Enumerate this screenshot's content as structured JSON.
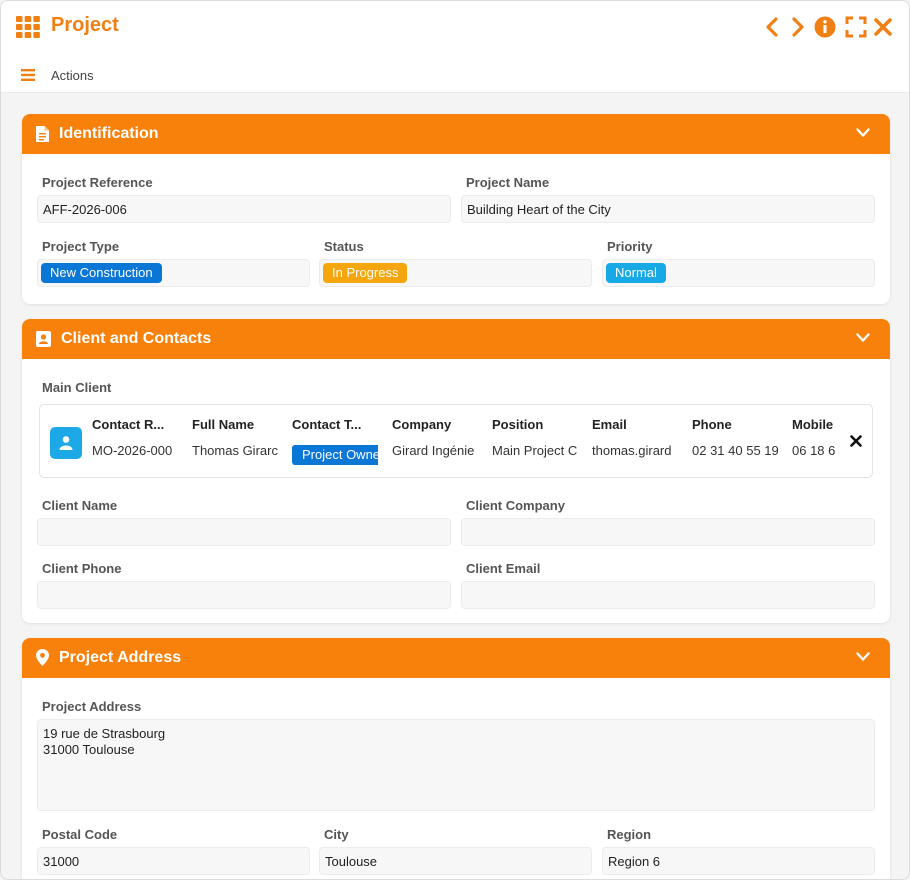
{
  "window": {
    "title": "Project",
    "accent": "#f07f14",
    "controls": [
      "chevron-left-icon",
      "chevron-right-icon",
      "info-icon",
      "fullscreen-icon",
      "close-icon"
    ]
  },
  "menubar": {
    "actions_label": "Actions"
  },
  "identification": {
    "title": "Identification",
    "project_reference_label": "Project Reference",
    "project_reference_value": "AFF-2026-006",
    "project_name_label": "Project Name",
    "project_name_value": "Building Heart of the City",
    "project_type_label": "Project Type",
    "project_type_value": "New Construction",
    "project_type_color": "#0a76d6",
    "status_label": "Status",
    "status_value": "In Progress",
    "status_color": "#f5a60c",
    "priority_label": "Priority",
    "priority_value": "Normal",
    "priority_color": "#16a9e6"
  },
  "client": {
    "title": "Client and Contacts",
    "main_client_label": "Main Client",
    "contact_columns": [
      "Contact R...",
      "Full Name",
      "Contact T...",
      "Company",
      "Position",
      "Email",
      "Phone",
      "Mobile"
    ],
    "contact_row": [
      "MO-2026-000",
      "Thomas Girarc",
      "Project Owne",
      "Girard Ingénie",
      "Main Project C",
      "thomas.girard",
      "02 31 40 55 19",
      "06 18 6"
    ],
    "client_name_label": "Client Name",
    "client_name_value": "",
    "client_company_label": "Client Company",
    "client_company_value": "",
    "client_phone_label": "Client Phone",
    "client_phone_value": "",
    "client_email_label": "Client Email",
    "client_email_value": ""
  },
  "address": {
    "title": "Project Address",
    "project_address_label": "Project Address",
    "project_address_value": "19 rue de Strasbourg\n31000 Toulouse",
    "postal_code_label": "Postal Code",
    "postal_code_value": "31000",
    "city_label": "City",
    "city_value": "Toulouse",
    "region_label": "Region",
    "region_value": "Region 6"
  }
}
